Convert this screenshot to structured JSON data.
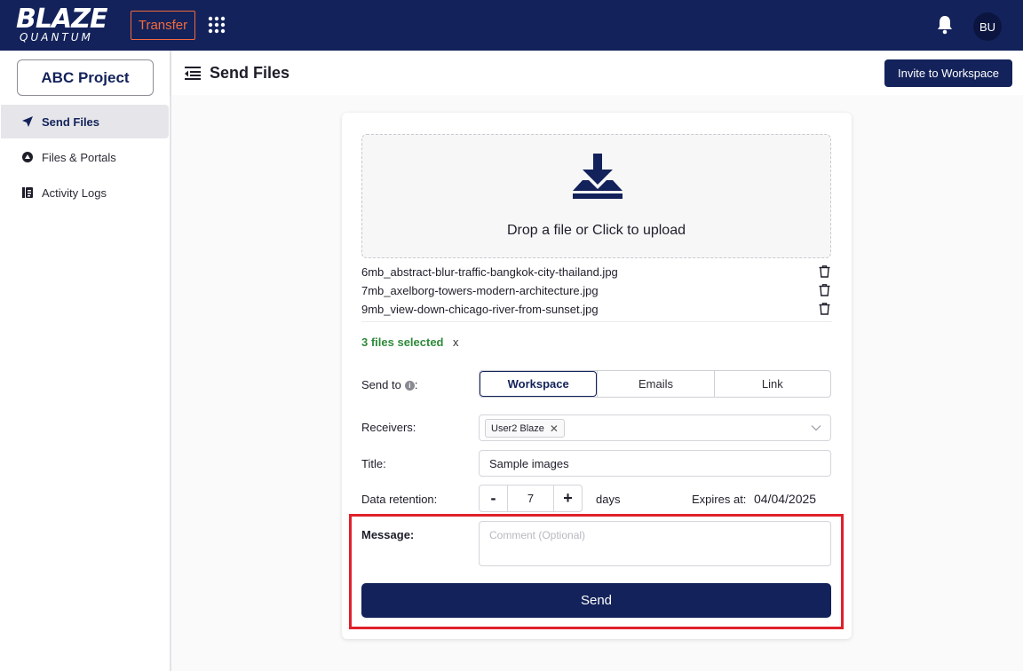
{
  "topbar": {
    "logo_line1": "BLAZE",
    "logo_line2": "QUANTUM",
    "product_label": "Transfer",
    "apps_icon": "grid-dots-icon",
    "bell_icon": "bell-icon",
    "avatar_initials": "BU",
    "colors": {
      "bar": "#13225a",
      "accent": "#f26a3d"
    }
  },
  "sidebar": {
    "project": "ABC Project",
    "items": [
      {
        "label": "Send Files",
        "icon": "send-icon",
        "active": true
      },
      {
        "label": "Files & Portals",
        "icon": "files-icon",
        "active": false
      },
      {
        "label": "Activity Logs",
        "icon": "activity-logs-icon",
        "active": false
      }
    ]
  },
  "header": {
    "title": "Send Files",
    "invite_label": "Invite to Workspace"
  },
  "upload": {
    "drop_text": "Drop a file or Click to upload",
    "files": [
      "6mb_abstract-blur-traffic-bangkok-city-thailand.jpg",
      "7mb_axelborg-towers-modern-architecture.jpg",
      "9mb_view-down-chicago-river-from-sunset.jpg"
    ],
    "selected_text": "3 files selected",
    "clear_label": "x"
  },
  "form": {
    "send_to_label": "Send to",
    "send_to_suffix": ":",
    "send_to_options": [
      "Workspace",
      "Emails",
      "Link"
    ],
    "send_to_selected": "Workspace",
    "receivers_label": "Receivers:",
    "receivers": [
      "User2 Blaze"
    ],
    "title_label": "Title:",
    "title_value": "Sample images",
    "retention_label": "Data retention:",
    "retention_value": "7",
    "retention_unit": "days",
    "minus_label": "-",
    "plus_label": "+",
    "expires_label": "Expires at:",
    "expires_value": "04/04/2025",
    "message_label": "Message:",
    "message_placeholder": "Comment (Optional)",
    "send_label": "Send"
  }
}
